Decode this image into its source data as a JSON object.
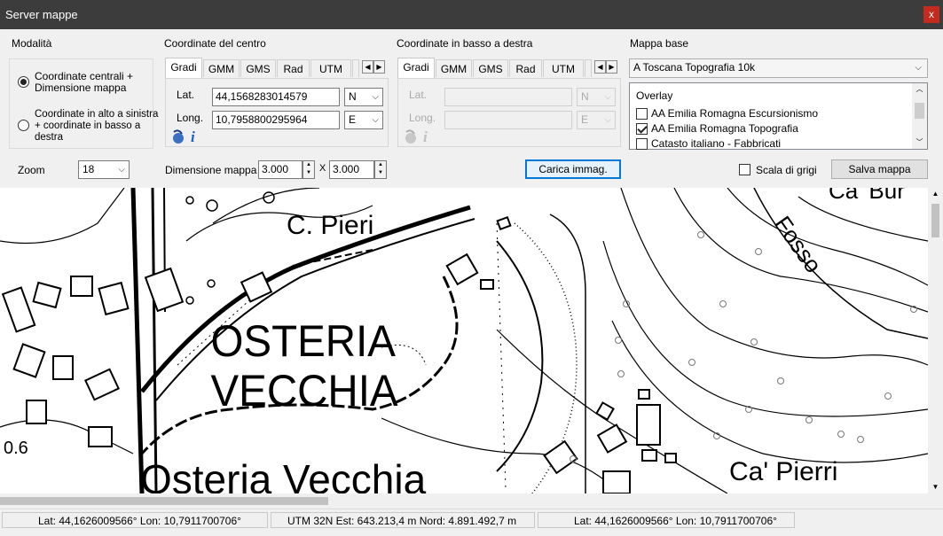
{
  "window": {
    "title": "Server mappe",
    "close_label": "x"
  },
  "mode": {
    "label": "Modalità",
    "option1": "Coordinate centrali + Dimensione mappa",
    "option1_line1": "Coordinate centrali +",
    "option1_line2": "Dimensione mappa",
    "option2_line1": "Coordinate in alto a sinistra",
    "option2_line2": "+ coordinate in basso a",
    "option2_line3": "destra",
    "selected": "option1"
  },
  "center": {
    "label": "Coordinate del centro",
    "tabs": [
      "Gradi",
      "GMM",
      "GMS",
      "Rad",
      "UTM"
    ],
    "active_tab": "Gradi",
    "lat_label": "Lat.",
    "lat_value": "44,1568283014579",
    "lat_hemi": "N",
    "lon_label": "Long.",
    "lon_value": "10,7958800295964",
    "lon_hemi": "E"
  },
  "bottom_right": {
    "label": "Coordinate in basso a destra",
    "tabs": [
      "Gradi",
      "GMM",
      "GMS",
      "Rad",
      "UTM"
    ],
    "active_tab": "Gradi",
    "lat_label": "Lat.",
    "lon_label": "Long.",
    "lat_hemi": "N",
    "lon_hemi": "E"
  },
  "base_map": {
    "label": "Mappa base",
    "selected": "A Toscana Topografia 10k",
    "overlay_label": "Overlay",
    "overlays": [
      {
        "label": "AA Emilia Romagna Escursionismo",
        "checked": false
      },
      {
        "label": "AA Emilia Romagna Topografia",
        "checked": true
      },
      {
        "label": "Catasto italiano - Fabbricati",
        "checked": false
      }
    ]
  },
  "controls": {
    "zoom_label": "Zoom",
    "zoom_value": "18",
    "size_label": "Dimensione mappa",
    "width_value": "3.000",
    "x_sep": "X",
    "height_value": "3.000",
    "load_button": "Carica immag.",
    "grayscale_label": "Scala di grigi",
    "grayscale_checked": false,
    "save_button": "Salva mappa"
  },
  "map": {
    "labels": [
      "Ca' Bur",
      "C. Pieri",
      "Fosso",
      "OSTERIA",
      "VECCHIA",
      "Ca' Pierri",
      "Osteria Vecchia",
      "0.6"
    ]
  },
  "status": {
    "cell1": "Lat: 44,1626009566°  Lon: 10,7911700706°",
    "cell2": "UTM 32N  Est: 643.213,4  m  Nord: 4.891.492,7  m",
    "cell3": "Lat: 44,1626009566°  Lon: 10,7911700706°"
  }
}
